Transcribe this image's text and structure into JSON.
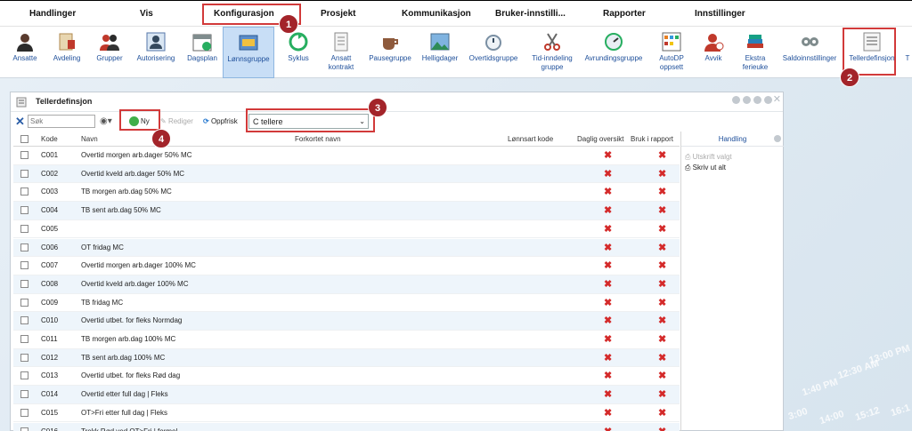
{
  "menu": [
    "Handlinger",
    "Vis",
    "Konfigurasjon",
    "Prosjekt",
    "Kommunikasjon",
    "Bruker-innstilli...",
    "Rapporter",
    "Innstillinger"
  ],
  "ribbon": [
    "Ansatte",
    "Avdeling",
    "Grupper",
    "Autorisering",
    "Dagsplan",
    "Lønnsgruppe",
    "Syklus",
    "Ansatt kontrakt",
    "Pausegruppe",
    "Helligdager",
    "Overtidsgruppe",
    "Tid-inndeling gruppe",
    "Avrundingsgruppe",
    "AutoDP oppsett",
    "Avvik",
    "Ekstra ferieuke",
    "Saldoinnstillinger",
    "Tellerdefinsjon",
    "T"
  ],
  "badges": [
    "1",
    "2",
    "3",
    "4"
  ],
  "window": {
    "title": "Tellerdefinsjon"
  },
  "toolbar": {
    "search_placeholder": "Søk",
    "new_label": "Ny",
    "edit_label": "Rediger",
    "refresh_label": "Oppfrisk",
    "filter_value": "C tellere"
  },
  "columns": {
    "kode": "Kode",
    "navn": "Navn",
    "forkortet": "Forkortet navn",
    "lonnsart": "Lønnsart kode",
    "daglig": "Daglig oversikt",
    "bruk": "Bruk i rapport"
  },
  "rows": [
    {
      "kode": "C001",
      "navn": "Overtid morgen arb.dager 50% MC"
    },
    {
      "kode": "C002",
      "navn": "Overtid kveld arb.dager 50% MC"
    },
    {
      "kode": "C003",
      "navn": "TB morgen arb.dag 50% MC"
    },
    {
      "kode": "C004",
      "navn": "TB sent arb.dag 50% MC"
    },
    {
      "kode": "C005",
      "navn": ""
    },
    {
      "kode": "C006",
      "navn": "OT fridag MC"
    },
    {
      "kode": "C007",
      "navn": "Overtid morgen arb.dager 100% MC"
    },
    {
      "kode": "C008",
      "navn": "Overtid kveld arb.dager 100% MC"
    },
    {
      "kode": "C009",
      "navn": "TB fridag MC"
    },
    {
      "kode": "C010",
      "navn": "Overtid utbet. for fleks Normdag"
    },
    {
      "kode": "C011",
      "navn": "TB morgen arb.dag 100% MC"
    },
    {
      "kode": "C012",
      "navn": "TB sent arb.dag 100% MC"
    },
    {
      "kode": "C013",
      "navn": "Overtid utbet. for fleks Rød dag"
    },
    {
      "kode": "C014",
      "navn": "Overtid etter full dag | Fleks"
    },
    {
      "kode": "C015",
      "navn": "OT>Fri etter full dag | Fleks"
    },
    {
      "kode": "C016",
      "navn": "Trekk Rød ved OT>Fri | formel"
    }
  ],
  "side": {
    "title": "Handling",
    "print_selected": "Utskrift valgt",
    "print_all": "Skriv ut alt"
  },
  "deco_times": [
    "1:40 PM",
    "12:30 AM",
    "13:00 PM",
    "3:00",
    "14:00",
    "15:12",
    "16:1"
  ],
  "colors": {
    "accent": "#1e4f9a",
    "annotation": "#d23a3a",
    "badge": "#a3242a",
    "delete": "#d42a2a"
  }
}
